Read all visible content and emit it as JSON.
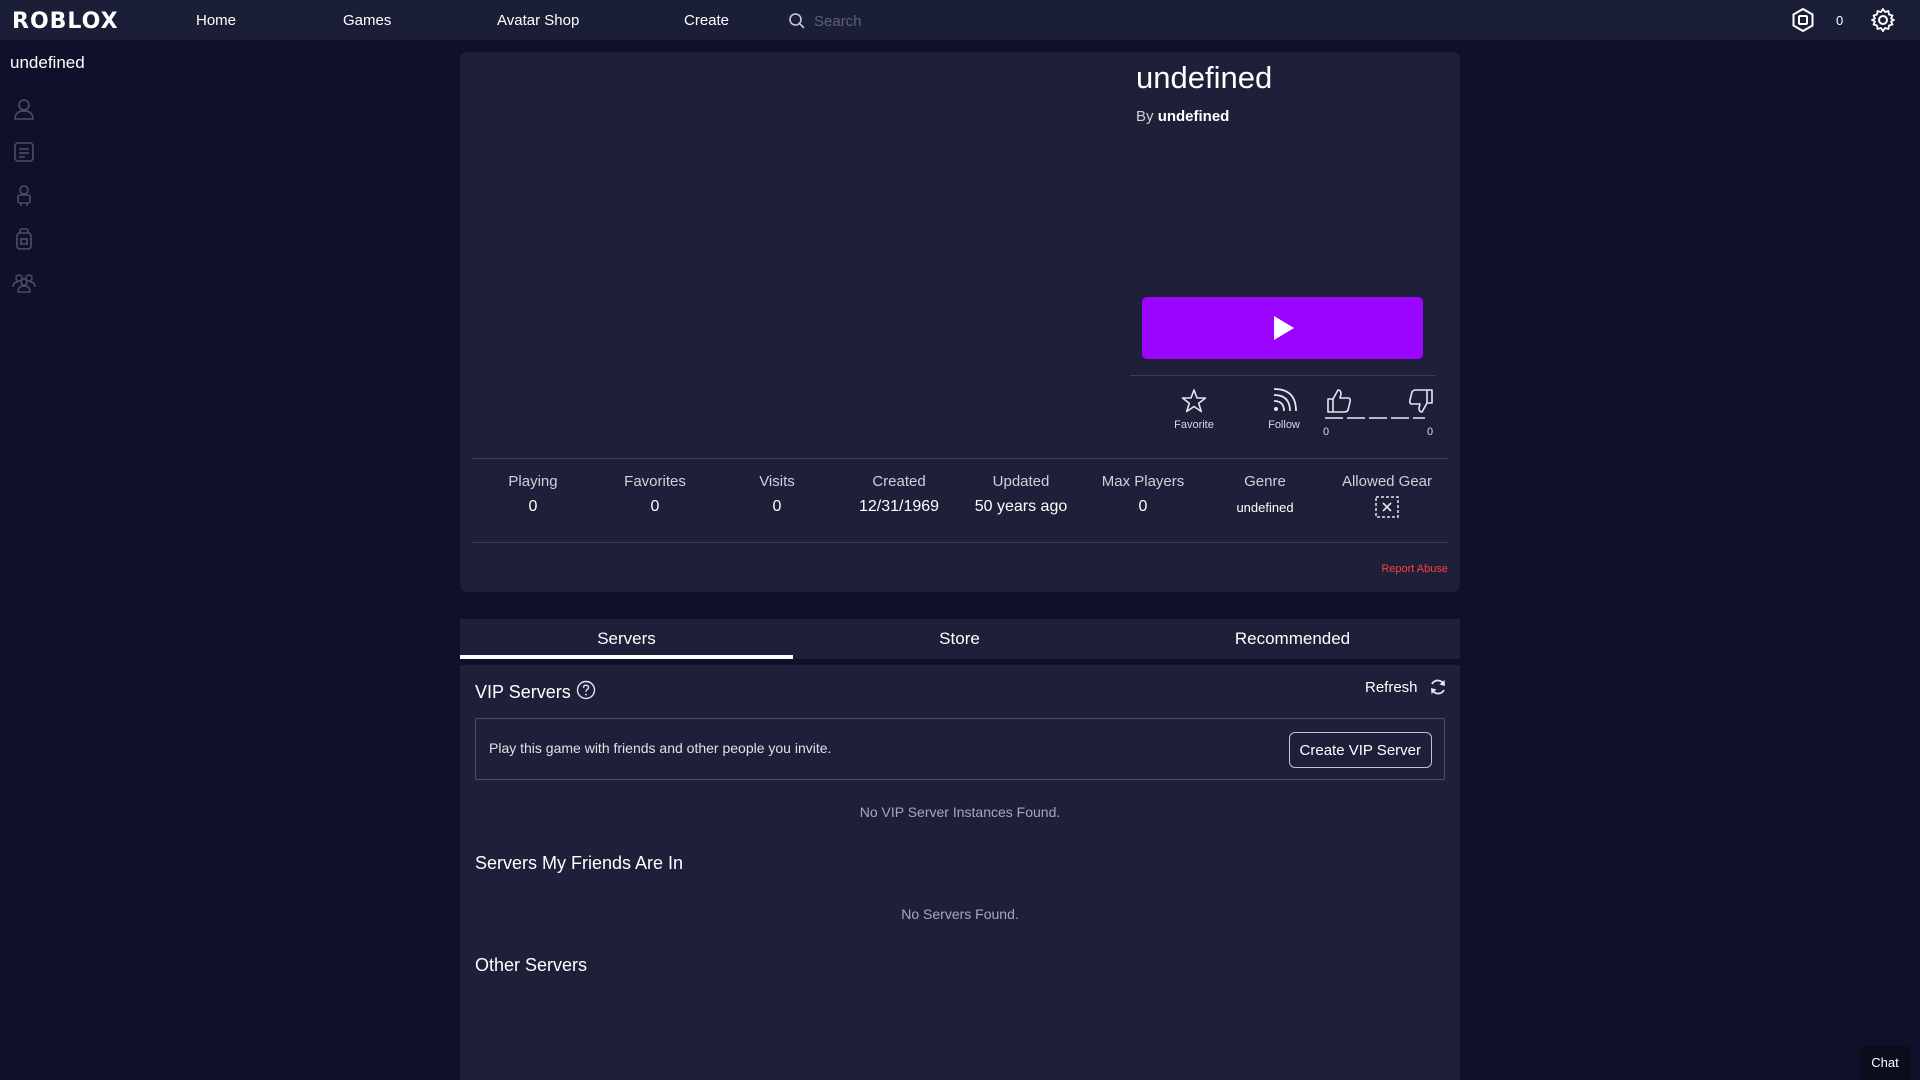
{
  "nav": {
    "logo": "ROBLOX",
    "links": [
      "Home",
      "Games",
      "Avatar Shop",
      "Create"
    ],
    "search_placeholder": "Search",
    "robux_count": "0"
  },
  "sidebar": {
    "username": "undefined",
    "icons": [
      "profile-icon",
      "messages-icon",
      "avatar-icon",
      "inventory-icon",
      "groups-icon"
    ]
  },
  "game": {
    "title": "undefined",
    "by_prefix": "By",
    "creator": "undefined",
    "actions": {
      "favorite_label": "Favorite",
      "follow_label": "Follow",
      "upvotes": "0",
      "downvotes": "0"
    },
    "stats": [
      {
        "label": "Playing",
        "value": "0"
      },
      {
        "label": "Favorites",
        "value": "0"
      },
      {
        "label": "Visits",
        "value": "0"
      },
      {
        "label": "Created",
        "value": "12/31/1969"
      },
      {
        "label": "Updated",
        "value": "50 years ago"
      },
      {
        "label": "Max Players",
        "value": "0"
      },
      {
        "label": "Genre",
        "value": "undefined"
      },
      {
        "label": "Allowed Gear",
        "value": ""
      }
    ],
    "report_abuse": "Report Abuse"
  },
  "tabs": [
    "Servers",
    "Store",
    "Recommended"
  ],
  "servers": {
    "vip_title": "VIP Servers",
    "refresh_label": "Refresh",
    "vip_description": "Play this game with friends and other people you invite.",
    "create_vip_label": "Create VIP Server",
    "vip_empty": "No VIP Server Instances Found.",
    "friends_title": "Servers My Friends Are In",
    "friends_empty": "No Servers Found.",
    "other_title": "Other Servers"
  },
  "chat_label": "Chat",
  "colors": {
    "background": "#0f112a",
    "panel": "#1e2039",
    "play_button": "#9a05ff",
    "report_abuse": "#ff3d3d"
  }
}
